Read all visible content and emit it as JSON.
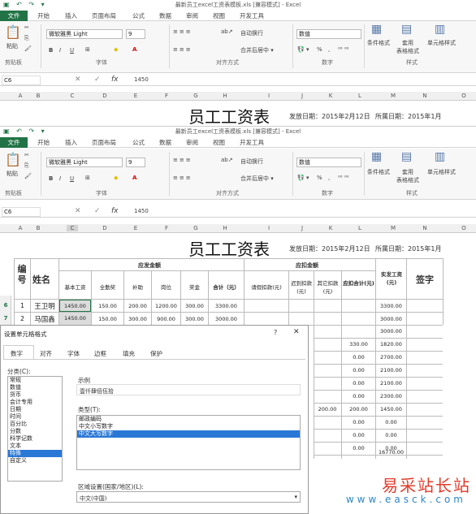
{
  "window": {
    "title": "最新员工excel工资表模板.xls [兼容模式] - Excel",
    "title_short": "最新员工excel工资表模板.xls [兼容模式] - Excel"
  },
  "ribbon_tabs": [
    "文件",
    "开始",
    "插入",
    "页面布局",
    "公式",
    "数据",
    "审阅",
    "视图",
    "开发工具"
  ],
  "ribbon": {
    "font_name": "微软雅黑 Light",
    "font_size": "9",
    "number_format": "数值",
    "wrap_text": "自动换行",
    "merge_center": "合并后居中 ▾",
    "cond_format": "条件格式",
    "table_format": "套用\n表格格式",
    "cell_style": "单元格样式",
    "groups": [
      "剪贴板",
      "字体",
      "对齐方式",
      "数字",
      "样式"
    ],
    "paste": "粘贴",
    "bold": "B",
    "italic": "I",
    "underline": "U",
    "percent": "%",
    "comma": ","
  },
  "formula_bar": {
    "name_box": "C6",
    "value": "1450",
    "fx": "fx"
  },
  "columns": [
    "A",
    "B",
    "C",
    "D",
    "E",
    "F",
    "G",
    "H",
    "I",
    "J",
    "K",
    "L",
    "M",
    "N",
    "O"
  ],
  "sheet": {
    "title": "员工工资表",
    "issue_date": "发放日期：2015年2月12日",
    "period": "所属日期：2015年1月",
    "headers": {
      "no": "编号",
      "name": "姓名",
      "payable": "应发金额",
      "deduct": "应扣金额",
      "net": "实发工资(元)",
      "sign": "签字",
      "sub_pay": [
        "基本工资",
        "全勤奖",
        "补助",
        "岗位",
        "奖金",
        "合计（元）"
      ],
      "sub_deduct": [
        "请假扣款(元)",
        "迟到扣款(元)",
        "其它扣款(元)",
        "应扣合计(元)"
      ]
    },
    "rows": [
      {
        "row": "6",
        "no": "1",
        "name": "王卫明",
        "vals": [
          "1450.00",
          "150.00",
          "200.00",
          "1200.00",
          "300.00",
          "3300.00"
        ],
        "net": "3300.00"
      },
      {
        "row": "7",
        "no": "2",
        "name": "马国鑫",
        "vals": [
          "1450.00",
          "150.00",
          "300.00",
          "900.00",
          "300.00",
          "3000.00"
        ],
        "net": "3000.00"
      }
    ],
    "right_column": [
      {
        "k": "",
        "l": "",
        "m": "3000.00"
      },
      {
        "k": "",
        "l": "330.00",
        "m": "1820.00"
      },
      {
        "k": "",
        "l": "0.00",
        "m": "2700.00"
      },
      {
        "k": "",
        "l": "0.00",
        "m": "2100.00"
      },
      {
        "k": "",
        "l": "0.00",
        "m": "2100.00"
      },
      {
        "k": "",
        "l": "0.00",
        "m": "2300.00"
      },
      {
        "k": "200.00",
        "l": "200.00",
        "m": "1450.00"
      },
      {
        "k": "",
        "l": "0.00",
        "m": "0.00"
      },
      {
        "k": "",
        "l": "0.00",
        "m": "0.00"
      },
      {
        "k": "",
        "l": "0.00",
        "m": "0.00"
      }
    ],
    "total": "16770.00"
  },
  "dialog": {
    "title": "设置单元格格式",
    "help": "?",
    "close": "✕",
    "tabs": [
      "数字",
      "对齐",
      "字体",
      "边框",
      "填充",
      "保护"
    ],
    "category_label": "分类(C):",
    "categories": [
      "常规",
      "数值",
      "货币",
      "会计专用",
      "日期",
      "时间",
      "百分比",
      "分数",
      "科学记数",
      "文本",
      "特殊",
      "自定义"
    ],
    "selected_category": "特殊",
    "sample_label": "示例",
    "sample_value": "壹仟肆佰伍拾",
    "type_label": "类型(T):",
    "types": [
      "邮政编码",
      "中文小写数字",
      "中文大写数字"
    ],
    "selected_type": "中文大写数字",
    "locale_label": "区域设置(国家/地区)(L):",
    "locale_value": "中文(中国)"
  },
  "watermark": {
    "line1": "易采站长站",
    "line2": "www.easck.com"
  }
}
